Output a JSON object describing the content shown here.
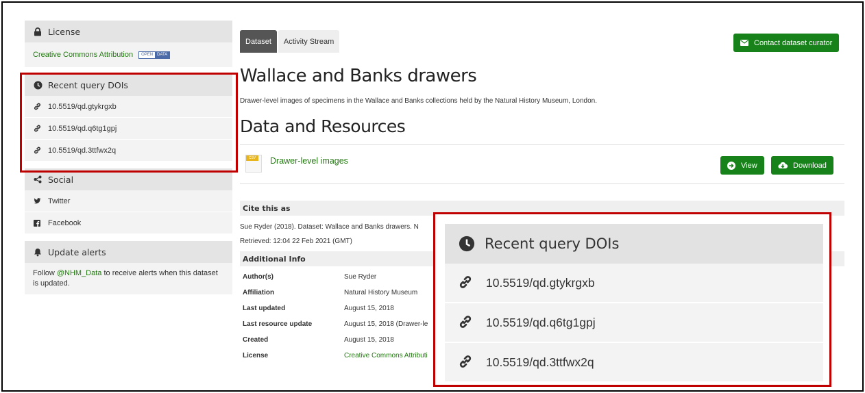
{
  "sidebar": {
    "license": {
      "title": "License",
      "link": "Creative Commons Attribution",
      "badge_left": "OPEN",
      "badge_right": "DATA"
    },
    "recent": {
      "title": "Recent query DOIs",
      "items": [
        "10.5519/qd.gtykrgxb",
        "10.5519/qd.q6tg1gpj",
        "10.5519/qd.3ttfwx2q"
      ]
    },
    "social": {
      "title": "Social",
      "items": [
        "Twitter",
        "Facebook"
      ]
    },
    "alerts": {
      "title": "Update alerts",
      "text_before": "Follow ",
      "handle": "@NHM_Data",
      "text_after": " to receive alerts when this dataset is updated."
    }
  },
  "main": {
    "tabs": [
      "Dataset",
      "Activity Stream"
    ],
    "contact_label": "Contact dataset curator",
    "title": "Wallace and Banks drawers",
    "description": "Drawer-level images of specimens in the Wallace and Banks collections held by the Natural History Museum, London.",
    "resources_title": "Data and Resources",
    "resource": {
      "format": "CSV",
      "name": "Drawer-level images",
      "view_label": "View",
      "download_label": "Download"
    },
    "cite": {
      "title": "Cite this as",
      "text": "Sue Ryder (2018). Dataset: Wallace and Banks drawers. N",
      "retrieved": "Retrieved: 12:04 22 Feb 2021 (GMT)"
    },
    "additional": {
      "title": "Additional Info",
      "rows": [
        {
          "key": "Author(s)",
          "value": "Sue Ryder"
        },
        {
          "key": "Affiliation",
          "value": "Natural History Museum"
        },
        {
          "key": "Last updated",
          "value": "August 15, 2018"
        },
        {
          "key": "Last resource update",
          "value": "August 15, 2018 (Drawer-le"
        },
        {
          "key": "Created",
          "value": "August 15, 2018"
        },
        {
          "key": "License",
          "value": "Creative Commons Attributi"
        }
      ]
    }
  },
  "zoom": {
    "title": "Recent query DOIs",
    "items": [
      "10.5519/qd.gtykrgxb",
      "10.5519/qd.q6tg1gpj",
      "10.5519/qd.3ttfwx2q"
    ]
  },
  "colors": {
    "accent_green": "#17811a",
    "link_green": "#237a11",
    "highlight_red": "#c00000"
  },
  "icons": {
    "license": "lock-icon",
    "recent": "clock-icon",
    "link": "link-icon",
    "social": "share-icon",
    "twitter": "twitter-icon",
    "facebook": "facebook-icon",
    "alerts": "bell-icon",
    "contact": "envelope-icon",
    "view": "arrow-circle-icon",
    "download": "cloud-download-icon"
  }
}
